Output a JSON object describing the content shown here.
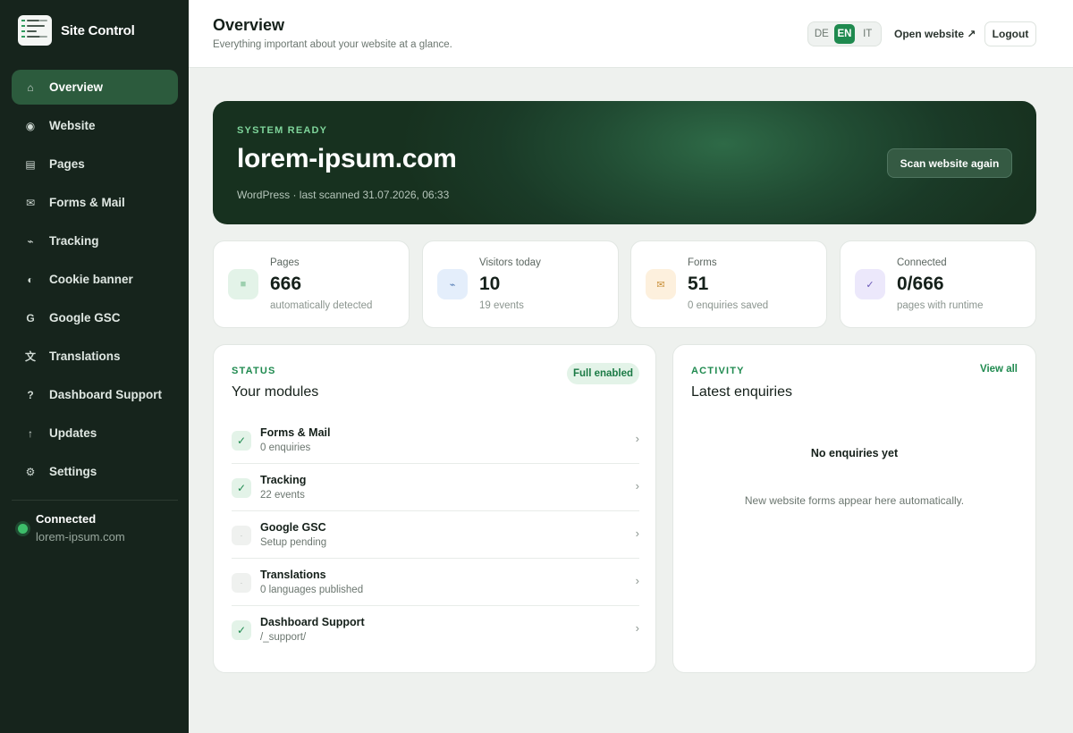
{
  "brand": {
    "name": "Site Control"
  },
  "sidebar": {
    "items": [
      {
        "icon": "home-icon",
        "glyph": "⌂",
        "label": "Overview",
        "active": true
      },
      {
        "icon": "globe-icon",
        "glyph": "◉",
        "label": "Website"
      },
      {
        "icon": "pages-icon",
        "glyph": "▤",
        "label": "Pages"
      },
      {
        "icon": "mail-icon",
        "glyph": "✉",
        "label": "Forms & Mail"
      },
      {
        "icon": "activity-icon",
        "glyph": "⌁",
        "label": "Tracking"
      },
      {
        "icon": "cookie-icon",
        "glyph": "◐",
        "label": "Cookie banner"
      },
      {
        "icon": "google-icon",
        "glyph": "G",
        "label": "Google GSC"
      },
      {
        "icon": "translate-icon",
        "glyph": "文",
        "label": "Translations"
      },
      {
        "icon": "help-icon",
        "glyph": "?",
        "label": "Dashboard Support"
      },
      {
        "icon": "arrow-up-icon",
        "glyph": "↑",
        "label": "Updates"
      },
      {
        "icon": "gear-icon",
        "glyph": "⚙",
        "label": "Settings"
      }
    ],
    "connection": {
      "title": "Connected",
      "domain": "lorem-ipsum.com",
      "status_color": "#3dbd6a"
    }
  },
  "header": {
    "title": "Overview",
    "subtitle": "Everything important about your website at a glance.",
    "languages": [
      "DE",
      "EN",
      "IT"
    ],
    "selected_language": "EN",
    "open_website": "Open website ↗",
    "logout": "Logout"
  },
  "hero": {
    "kicker": "SYSTEM READY",
    "domain": "lorem-ipsum.com",
    "meta": "WordPress · last scanned 31.07.2026, 06:33",
    "scan_button": "Scan website again"
  },
  "stats": [
    {
      "icon": "pages-icon",
      "glyph": "■",
      "icon_bg": "#e3f3e8",
      "icon_color": "#9ccfae",
      "label": "Pages",
      "value": "666",
      "sub": "automatically detected"
    },
    {
      "icon": "activity-icon",
      "glyph": "⌁",
      "icon_bg": "#e4eefb",
      "icon_color": "#5a82b8",
      "label": "Visitors today",
      "value": "10",
      "sub": "19 events"
    },
    {
      "icon": "mail-icon",
      "glyph": "✉",
      "icon_bg": "#fdf0dd",
      "icon_color": "#c9913c",
      "label": "Forms",
      "value": "51",
      "sub": "0 enquiries saved"
    },
    {
      "icon": "check-icon",
      "glyph": "✓",
      "icon_bg": "#ece8fb",
      "icon_color": "#6a58b8",
      "label": "Connected",
      "value": "0/666",
      "sub": "pages with runtime"
    }
  ],
  "modules_panel": {
    "kicker": "STATUS",
    "title": "Your modules",
    "badge": "Full enabled",
    "modules": [
      {
        "name": "Forms & Mail",
        "sub": "0 enquiries",
        "done": true
      },
      {
        "name": "Tracking",
        "sub": "22 events",
        "done": true
      },
      {
        "name": "Google GSC",
        "sub": "Setup pending",
        "done": false
      },
      {
        "name": "Translations",
        "sub": "0 languages published",
        "done": false
      },
      {
        "name": "Dashboard Support",
        "sub": "/_support/",
        "done": true
      }
    ]
  },
  "activity_panel": {
    "kicker": "ACTIVITY",
    "title": "Latest enquiries",
    "view_all": "View all",
    "empty_title": "No enquiries yet",
    "empty_sub": "New website forms appear here automatically."
  },
  "colors": {
    "accent": "#1f8a4f",
    "sidebar_bg": "#16241c",
    "hero_bg": "#1e4430"
  }
}
